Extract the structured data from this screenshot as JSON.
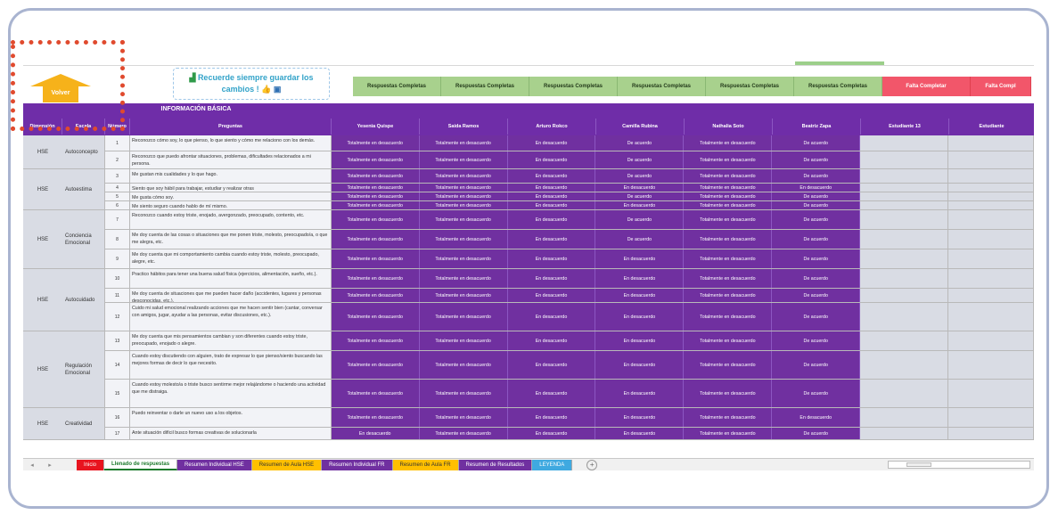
{
  "reminder": {
    "line1": "Recuerde siempre guardar los",
    "line2": "cambios !"
  },
  "volver_label": "Volver",
  "status_row": [
    {
      "label": "Respuestas Completas",
      "state": "ok"
    },
    {
      "label": "Respuestas Completas",
      "state": "ok"
    },
    {
      "label": "Respuestas Completas",
      "state": "ok"
    },
    {
      "label": "Respuestas Completas",
      "state": "ok"
    },
    {
      "label": "Respuestas Completas",
      "state": "ok"
    },
    {
      "label": "Respuestas Completas",
      "state": "ok"
    },
    {
      "label": "Falta Completar",
      "state": "missing"
    },
    {
      "label": "Falta Compl",
      "state": "missing"
    }
  ],
  "header": {
    "title": "INFORMACIÓN BÁSICA",
    "columns": [
      "Dimensión",
      "Escala",
      "Número",
      "Preguntas",
      "Yesenia Quispe",
      "Saida Ramos",
      "Arturo Rokco",
      "Camilla Rubina",
      "Nathalia Soto",
      "Beatriz Zapa",
      "Estudiante 13",
      "Estudiante"
    ]
  },
  "groups": [
    {
      "dimension": "HSE",
      "escala": "Autoconcepto"
    },
    {
      "dimension": "HSE",
      "escala": "Autoestima"
    },
    {
      "dimension": "HSE",
      "escala": "Conciencia Emocional"
    },
    {
      "dimension": "HSE",
      "escala": "Autocuidado"
    },
    {
      "dimension": "HSE",
      "escala": "Regulación Emocional"
    },
    {
      "dimension": "HSE",
      "escala": "Creatividad"
    }
  ],
  "rows": [
    {
      "num": "1",
      "q": "Reconozco cómo soy, lo que pienso, lo que siento y cómo me relaciono con los demás.",
      "answers": [
        "Totalmente en desacuerdo",
        "Totalmente en desacuerdo",
        "En desacuerdo",
        "De acuerdo",
        "Totalmente en desacuerdo",
        "De acuerdo"
      ]
    },
    {
      "num": "2",
      "q": "Reconozco que puedo afrontar situaciones, problemas, dificultades relacionados a mi persona.",
      "answers": [
        "Totalmente en desacuerdo",
        "Totalmente en desacuerdo",
        "En desacuerdo",
        "De acuerdo",
        "Totalmente en desacuerdo",
        "De acuerdo"
      ]
    },
    {
      "num": "3",
      "q": "Me gustan mis cualidades y lo que hago.",
      "answers": [
        "Totalmente en desacuerdo",
        "Totalmente en desacuerdo",
        "En desacuerdo",
        "De acuerdo",
        "Totalmente en desacuerdo",
        "De acuerdo"
      ]
    },
    {
      "num": "4",
      "q": "Siento que soy hábil para trabajar, estudiar y realizar otras",
      "answers": [
        "Totalmente en desacuerdo",
        "Totalmente en desacuerdo",
        "En desacuerdo",
        "En desacuerdo",
        "Totalmente en desacuerdo",
        "En desacuerdo"
      ]
    },
    {
      "num": "5",
      "q": "Me gusta cómo soy.",
      "answers": [
        "Totalmente en desacuerdo",
        "Totalmente en desacuerdo",
        "En desacuerdo",
        "De acuerdo",
        "Totalmente en desacuerdo",
        "De acuerdo"
      ]
    },
    {
      "num": "6",
      "q": "Me siento seguro cuando hablo de mí mismo.",
      "answers": [
        "Totalmente en desacuerdo",
        "Totalmente en desacuerdo",
        "En desacuerdo",
        "En desacuerdo",
        "Totalmente en desacuerdo",
        "De acuerdo"
      ]
    },
    {
      "num": "7",
      "q": "Reconozco cuando estoy triste, enojado, avergonzado, preocupado, contento, etc.",
      "answers": [
        "Totalmente en desacuerdo",
        "Totalmente en desacuerdo",
        "En desacuerdo",
        "De acuerdo",
        "Totalmente en desacuerdo",
        "De acuerdo"
      ]
    },
    {
      "num": "8",
      "q": "Me doy cuenta de las cosas o situaciones que me ponen triste, molesto, preocupado/a, o que me alegra, etc.",
      "answers": [
        "Totalmente en desacuerdo",
        "Totalmente en desacuerdo",
        "En desacuerdo",
        "De acuerdo",
        "Totalmente en desacuerdo",
        "De acuerdo"
      ]
    },
    {
      "num": "9",
      "q": "Me doy cuenta que mi comportamiento cambia cuando estoy triste, molesto, preocupado, alegre, etc.",
      "answers": [
        "Totalmente en desacuerdo",
        "Totalmente en desacuerdo",
        "En desacuerdo",
        "En desacuerdo",
        "Totalmente en desacuerdo",
        "De acuerdo"
      ]
    },
    {
      "num": "10",
      "q": "Practico hábitos para tener una buena salud física (ejercicios, alimentación, sueño, etc.).",
      "answers": [
        "Totalmente en desacuerdo",
        "Totalmente en desacuerdo",
        "En desacuerdo",
        "En desacuerdo",
        "Totalmente en desacuerdo",
        "De acuerdo"
      ]
    },
    {
      "num": "11",
      "q": "Me doy cuenta de situaciones que me pueden hacer daño (accidentes, lugares y personas desconocidas, etc.).",
      "answers": [
        "Totalmente en desacuerdo",
        "Totalmente en desacuerdo",
        "En desacuerdo",
        "En desacuerdo",
        "Totalmente en desacuerdo",
        "De acuerdo"
      ]
    },
    {
      "num": "12",
      "q": "Cuido mi salud emocional realizando acciones que me hacen sentir bien (cantar, conversar con amigos, jugar, ayudar a las personas, evitar discusiones, etc.).",
      "answers": [
        "Totalmente en desacuerdo",
        "Totalmente en desacuerdo",
        "En desacuerdo",
        "En desacuerdo",
        "Totalmente en desacuerdo",
        "De acuerdo"
      ]
    },
    {
      "num": "13",
      "q": "Me doy cuenta que mis pensamientos cambian y son diferentes cuando estoy triste, preocupado, enojado o alegre.",
      "answers": [
        "Totalmente en desacuerdo",
        "Totalmente en desacuerdo",
        "En desacuerdo",
        "En desacuerdo",
        "Totalmente en desacuerdo",
        "De acuerdo"
      ]
    },
    {
      "num": "14",
      "q": "Cuando estoy discutiendo con alguien, trato de expresar lo que pienso/siento buscando las mejores formas de decir lo que necesito.",
      "answers": [
        "Totalmente en desacuerdo",
        "Totalmente en desacuerdo",
        "En desacuerdo",
        "En desacuerdo",
        "Totalmente en desacuerdo",
        "De acuerdo"
      ]
    },
    {
      "num": "15",
      "q": "Cuando estoy molesto/a o triste busco sentirme mejor relajándome o haciendo una actividad que me distraiga.",
      "answers": [
        "Totalmente en desacuerdo",
        "Totalmente en desacuerdo",
        "En desacuerdo",
        "En desacuerdo",
        "Totalmente en desacuerdo",
        "De acuerdo"
      ]
    },
    {
      "num": "16",
      "q": "Puedo reinventar o darle un nuevo uso a los objetos.",
      "answers": [
        "Totalmente en desacuerdo",
        "Totalmente en desacuerdo",
        "En desacuerdo",
        "En desacuerdo",
        "Totalmente en desacuerdo",
        "En desacuerdo"
      ]
    },
    {
      "num": "17",
      "q": "Ante situación difícil busco formas creativas de solucionarla",
      "answers": [
        "En desacuerdo",
        "Totalmente en desacuerdo",
        "En desacuerdo",
        "En desacuerdo",
        "Totalmente en desacuerdo",
        "De acuerdo"
      ]
    }
  ],
  "tabs": [
    {
      "label": "Inicio",
      "color": "#e8141f"
    },
    {
      "label": "Llenado de respuestas",
      "color": "#ffffff"
    },
    {
      "label": "Resumen Individual HSE",
      "color": "#7030a0"
    },
    {
      "label": "Resumen de Aula HSE",
      "color": "#ffc000"
    },
    {
      "label": "Resumen Individual FR",
      "color": "#7030a0"
    },
    {
      "label": "Resumen de Aula FR",
      "color": "#ffc000"
    },
    {
      "label": "Resumen de Resultados",
      "color": "#7030a0"
    },
    {
      "label": "LEYENDA",
      "color": "#3fa9e0"
    }
  ]
}
